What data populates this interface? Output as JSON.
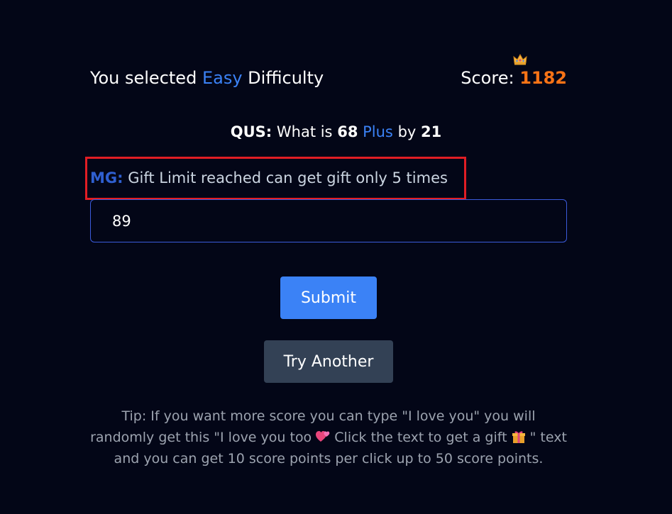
{
  "colors": {
    "accent": "#3b82f6",
    "score": "#f97316",
    "mg_label": "#2f5fd0",
    "primary_button": "#3b82f6",
    "highlight_border": "#e11d24"
  },
  "header": {
    "selected_prefix": "You selected",
    "difficulty": "Easy",
    "selected_suffix": "Difficulty",
    "score_label": "Score:",
    "score_value": "1182",
    "score_icon": "crown-icon"
  },
  "question": {
    "label": "QUS:",
    "text_prefix": "What is",
    "operand_a": "68",
    "operation": "Plus",
    "by_word": "by",
    "operand_b": "21"
  },
  "message": {
    "label": "MG:",
    "text": "Gift Limit reached can get gift only 5 times"
  },
  "answer_input": {
    "value": "89"
  },
  "buttons": {
    "submit": "Submit",
    "try_another": "Try Another"
  },
  "tip": {
    "part1": "Tip: If you want more score you can type \"I love you\" you will randomly get this \"I love you too",
    "heart_icon": "two-hearts-icon",
    "part2": "Click the text to get a gift",
    "gift_icon": "gift-icon",
    "part3": "\" text and you can get 10 score points per click up to 50 score points."
  }
}
